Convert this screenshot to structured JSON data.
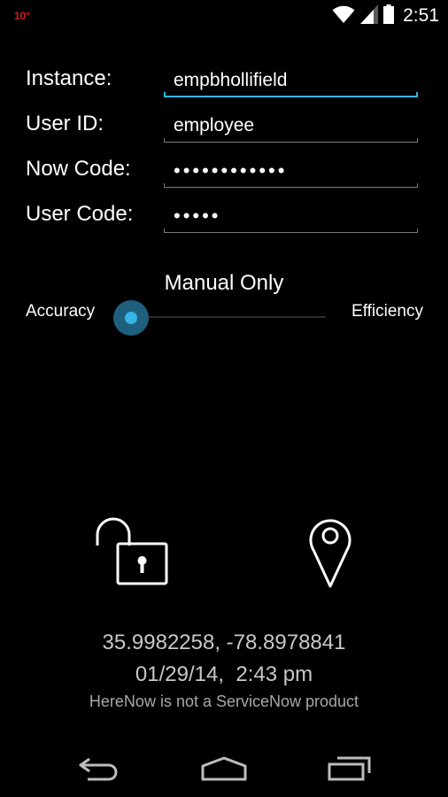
{
  "status_bar": {
    "temperature": "10°",
    "time": "2:51",
    "icons": [
      "wifi-icon",
      "signal-icon",
      "battery-icon"
    ]
  },
  "form": {
    "instance": {
      "label": "Instance:",
      "value": "empbhollifield",
      "focused": true
    },
    "user_id": {
      "label": "User ID:",
      "value": "employee"
    },
    "now_code": {
      "label": "Now Code:",
      "value": "••••••••••••"
    },
    "user_code": {
      "label": "User Code:",
      "value": "•••••"
    }
  },
  "tracking": {
    "mode": "Manual Only",
    "left_label": "Accuracy",
    "right_label": "Efficiency",
    "level": 0
  },
  "actions": {
    "lock_icon": "unlocked-padlock-icon",
    "location_icon": "map-pin-icon"
  },
  "info": {
    "coordinates": "35.9982258, -78.8978841",
    "datetime": "01/29/14,  2:43 pm",
    "disclaimer": "HereNow is not a ServiceNow product"
  },
  "nav": {
    "icons": [
      "back-icon",
      "home-icon",
      "recent-apps-icon"
    ]
  },
  "colors": {
    "accent": "#33b5e5",
    "background": "#000000",
    "text": "#ffffff",
    "muted_text": "#c8c8c8"
  }
}
